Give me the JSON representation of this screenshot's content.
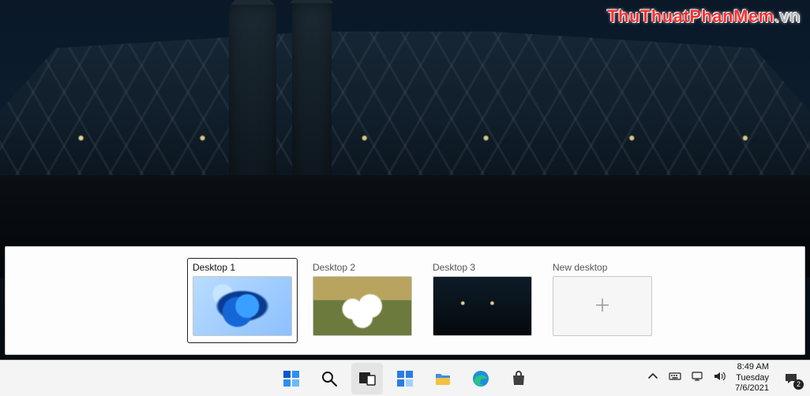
{
  "watermark": {
    "main": "ThuThuatPhanMem",
    "suffix": ".vn"
  },
  "taskview": {
    "desktops": [
      {
        "label": "Desktop 1",
        "thumb": "bloom",
        "selected": true
      },
      {
        "label": "Desktop 2",
        "thumb": "flowers",
        "selected": false
      },
      {
        "label": "Desktop 3",
        "thumb": "bridge",
        "selected": false
      }
    ],
    "new_desktop_label": "New desktop"
  },
  "taskbar": {
    "apps": [
      {
        "name": "start-button",
        "icon": "windows-icon",
        "active": false
      },
      {
        "name": "search-button",
        "icon": "search-icon",
        "active": false
      },
      {
        "name": "task-view-button",
        "icon": "taskview-icon",
        "active": true
      },
      {
        "name": "widgets-button",
        "icon": "widgets-icon",
        "active": false
      },
      {
        "name": "file-explorer-button",
        "icon": "folder-icon",
        "active": false
      },
      {
        "name": "edge-button",
        "icon": "edge-icon",
        "active": false
      },
      {
        "name": "store-button",
        "icon": "store-icon",
        "active": false
      }
    ]
  },
  "tray": {
    "icons": [
      {
        "name": "chevron-up-icon"
      },
      {
        "name": "keyboard-icon"
      },
      {
        "name": "network-icon"
      },
      {
        "name": "volume-icon"
      }
    ],
    "clock": {
      "time": "8:49 AM",
      "day": "Tuesday",
      "date": "7/6/2021"
    },
    "notification_count": "2"
  }
}
